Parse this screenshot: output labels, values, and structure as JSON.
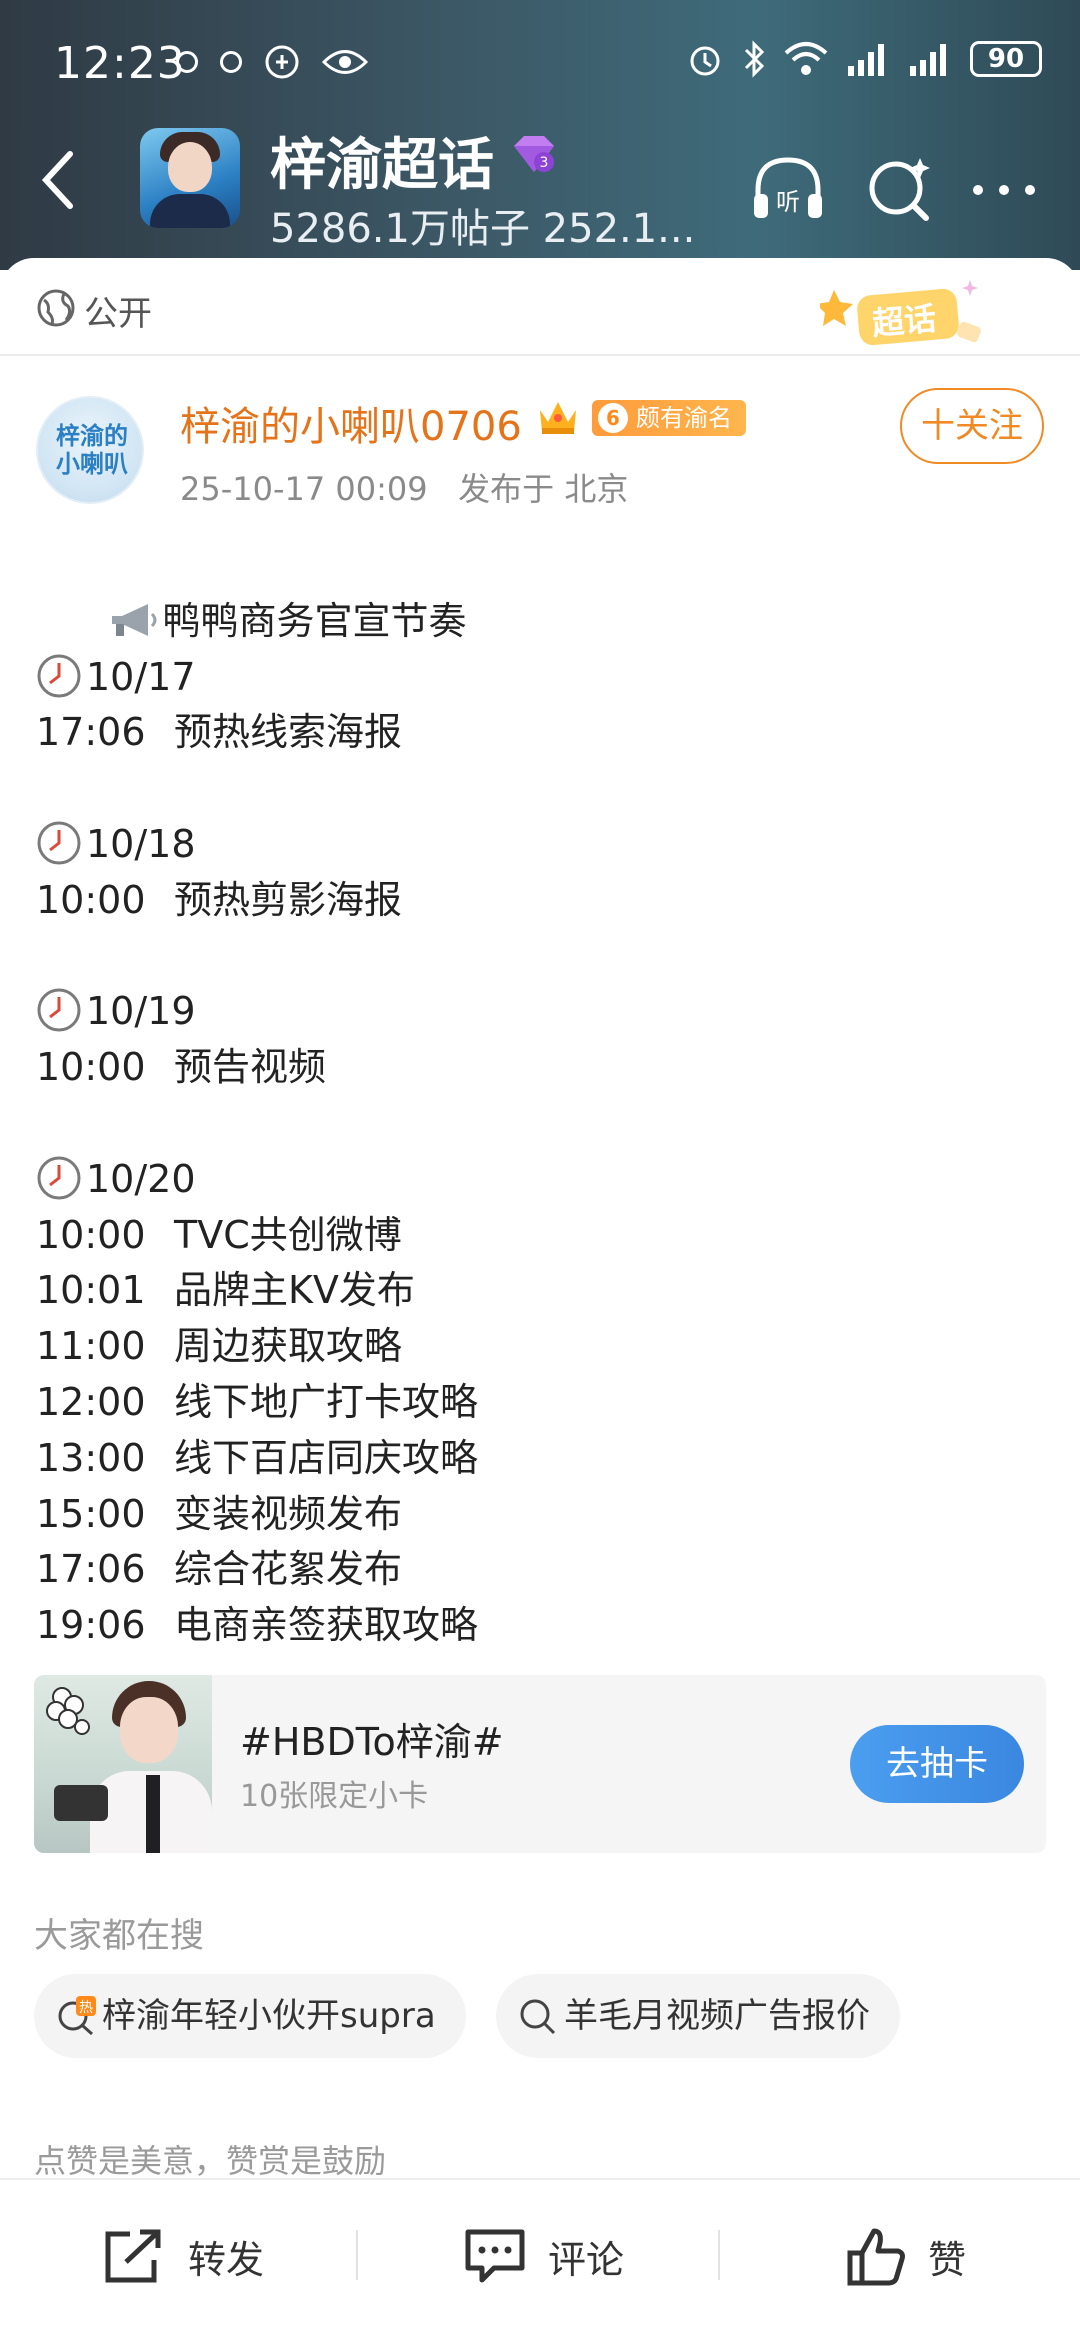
{
  "status": {
    "time": "12:23",
    "battery": "90"
  },
  "header": {
    "title": "梓渝超话",
    "subtitle": "5286.1万帖子 252.1..."
  },
  "visibility": {
    "label": "公开",
    "tag": "超话"
  },
  "post": {
    "author": "梓渝的小喇叭0706",
    "badge_level": "6",
    "badge_text": "颇有渝名",
    "avatar_text": "梓渝的小喇叭",
    "time": "25-10-17 00:09",
    "location": "发布于 北京",
    "follow_label": "十关注",
    "headline": "鸭鸭商务官宣节奏",
    "schedule": [
      {
        "date": "10/17",
        "items": [
          {
            "time": "17:06",
            "text": "预热线索海报"
          }
        ]
      },
      {
        "date": "10/18",
        "items": [
          {
            "time": "10:00",
            "text": "预热剪影海报"
          }
        ]
      },
      {
        "date": "10/19",
        "items": [
          {
            "time": "10:00",
            "text": "预告视频"
          }
        ]
      },
      {
        "date": "10/20",
        "items": [
          {
            "time": "10:00",
            "text": "TVC共创微博"
          },
          {
            "time": "10:01",
            "text": "品牌主KV发布"
          },
          {
            "time": "11:00",
            "text": "周边获取攻略"
          },
          {
            "time": "12:00",
            "text": "线下地广打卡攻略"
          },
          {
            "time": "13:00",
            "text": "线下百店同庆攻略"
          },
          {
            "time": "15:00",
            "text": "变装视频发布"
          },
          {
            "time": "17:06",
            "text": "综合花絮发布"
          },
          {
            "time": "19:06",
            "text": "电商亲签获取攻略"
          }
        ]
      }
    ]
  },
  "topic_card": {
    "title": "#HBDTo梓渝#",
    "subtitle": "10张限定小卡",
    "button": "去抽卡"
  },
  "search": {
    "heading": "大家都在搜",
    "chips": [
      {
        "label": "梓渝年轻小伙开supra",
        "hot": "热"
      },
      {
        "label": "羊毛月视频广告报价"
      }
    ]
  },
  "reward_text": "点赞是美意，赞赏是鼓励",
  "bottom_bar": {
    "repost": "转发",
    "comment": "评论",
    "like": "赞"
  },
  "colors": {
    "accent_orange": "#f08a24",
    "author_orange": "#e5731a",
    "button_blue": "#3a87e0"
  }
}
